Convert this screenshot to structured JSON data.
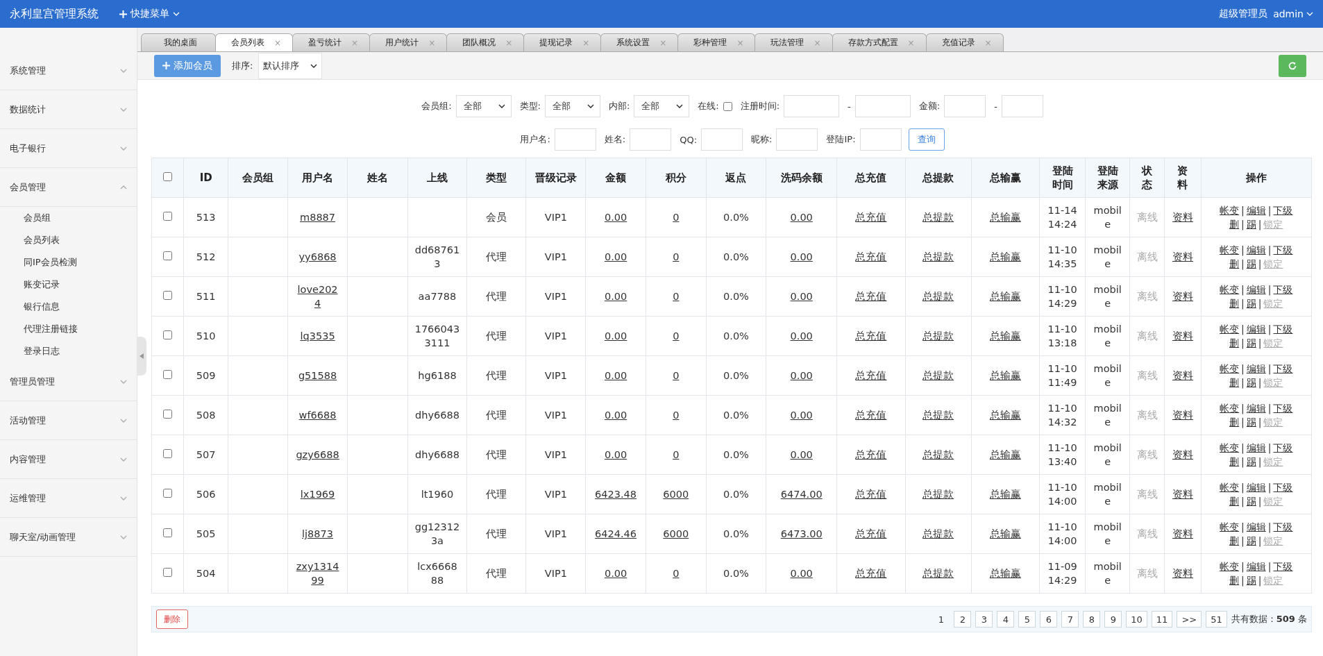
{
  "app_title": "永利皇宫管理系统",
  "quick_menu": "快捷菜单",
  "user": {
    "role": "超级管理员",
    "name": "admin"
  },
  "sidebar": [
    {
      "label": "系统管理",
      "expanded": false
    },
    {
      "label": "数据统计",
      "expanded": false
    },
    {
      "label": "电子银行",
      "expanded": false
    },
    {
      "label": "会员管理",
      "expanded": true,
      "children": [
        {
          "label": "会员组"
        },
        {
          "label": "会员列表"
        },
        {
          "label": "同IP会员检测"
        },
        {
          "label": "账变记录"
        },
        {
          "label": "银行信息"
        },
        {
          "label": "代理注册链接"
        },
        {
          "label": "登录日志"
        }
      ]
    },
    {
      "label": "管理员管理",
      "expanded": false
    },
    {
      "label": "活动管理",
      "expanded": false
    },
    {
      "label": "内容管理",
      "expanded": false
    },
    {
      "label": "运维管理",
      "expanded": false
    },
    {
      "label": "聊天室/动画管理",
      "expanded": false
    }
  ],
  "tabs": [
    {
      "label": "我的桌面",
      "selected": false
    },
    {
      "label": "会员列表",
      "selected": true,
      "close": "×"
    },
    {
      "label": "盈亏统计",
      "selected": false,
      "close": "×"
    },
    {
      "label": "用户统计",
      "selected": false,
      "close": "×"
    },
    {
      "label": "团队概况",
      "selected": false,
      "close": "×"
    },
    {
      "label": "提现记录",
      "selected": false,
      "close": "×"
    },
    {
      "label": "系统设置",
      "selected": false,
      "close": "×"
    },
    {
      "label": "彩种管理",
      "selected": false,
      "close": "×"
    },
    {
      "label": "玩法管理",
      "selected": false,
      "close": "×"
    },
    {
      "label": "存款方式配置",
      "selected": false,
      "close": "×"
    },
    {
      "label": "充值记录",
      "selected": false,
      "close": "×"
    }
  ],
  "toolbar": {
    "add_button": "添加会员",
    "sort_label": "排序:",
    "sort_value": "默认排序"
  },
  "filters": {
    "row1": [
      {
        "kind": "select",
        "label": "会员组:",
        "value": "全部"
      },
      {
        "kind": "select",
        "label": "类型:",
        "value": "全部"
      },
      {
        "kind": "select",
        "label": "内部:",
        "value": "全部"
      },
      {
        "kind": "checkbox",
        "label": "在线:",
        "checked": false
      },
      {
        "kind": "range",
        "label": "注册时间:",
        "separator": "-"
      },
      {
        "kind": "range",
        "label": "金额:",
        "separator": "-"
      }
    ],
    "row2": [
      {
        "label": "用户名:"
      },
      {
        "label": "姓名:"
      },
      {
        "label": "QQ:"
      },
      {
        "label": "昵称:"
      },
      {
        "label": "登陆IP:"
      }
    ],
    "search_button": "查询"
  },
  "table": {
    "all_checked": false,
    "columns": [
      "ID",
      "会员组",
      "用户名",
      "姓名",
      "上线",
      "类型",
      "晋级记录",
      "金额",
      "积分",
      "返点",
      "洗码余额",
      "总充值",
      "总提款",
      "总输赢",
      "登陆时间",
      "登陆来源",
      "状态",
      "资料",
      "操作"
    ],
    "op_separator": "|",
    "rows": [
      {
        "selected": false,
        "id": "513",
        "group": "",
        "username": "m8887",
        "name": "",
        "parent": "",
        "type": "会员",
        "level": "VIP1",
        "amount": "0.00",
        "points": "0",
        "rebate": "0.0%",
        "wash": "0.00",
        "recharge": "总充值",
        "withdraw": "总提款",
        "winloss": "总输赢",
        "login_time": "11-14 14:24",
        "source": "mobile",
        "status": "离线",
        "profile": "资料",
        "ops": [
          {
            "label": "帐变",
            "disabled": false
          },
          {
            "label": "编辑",
            "disabled": false
          },
          {
            "label": "下级",
            "disabled": false
          },
          {
            "label": "删",
            "disabled": false
          },
          {
            "label": "踢",
            "disabled": false
          },
          {
            "label": "锁定",
            "disabled": true
          }
        ]
      },
      {
        "selected": false,
        "id": "512",
        "group": "",
        "username": "yy6868",
        "name": "",
        "parent": "dd687613",
        "type": "代理",
        "level": "VIP1",
        "amount": "0.00",
        "points": "0",
        "rebate": "0.0%",
        "wash": "0.00",
        "recharge": "总充值",
        "withdraw": "总提款",
        "winloss": "总输赢",
        "login_time": "11-10 14:35",
        "source": "mobile",
        "status": "离线",
        "profile": "资料",
        "ops": [
          {
            "label": "帐变",
            "disabled": false
          },
          {
            "label": "编辑",
            "disabled": false
          },
          {
            "label": "下级",
            "disabled": false
          },
          {
            "label": "删",
            "disabled": false
          },
          {
            "label": "踢",
            "disabled": false
          },
          {
            "label": "锁定",
            "disabled": true
          }
        ]
      },
      {
        "selected": false,
        "id": "511",
        "group": "",
        "username": "love2024",
        "name": "",
        "parent": "aa7788",
        "type": "代理",
        "level": "VIP1",
        "amount": "0.00",
        "points": "0",
        "rebate": "0.0%",
        "wash": "0.00",
        "recharge": "总充值",
        "withdraw": "总提款",
        "winloss": "总输赢",
        "login_time": "11-10 14:29",
        "source": "mobile",
        "status": "离线",
        "profile": "资料",
        "ops": [
          {
            "label": "帐变",
            "disabled": false
          },
          {
            "label": "编辑",
            "disabled": false
          },
          {
            "label": "下级",
            "disabled": false
          },
          {
            "label": "删",
            "disabled": false
          },
          {
            "label": "踢",
            "disabled": false
          },
          {
            "label": "锁定",
            "disabled": true
          }
        ]
      },
      {
        "selected": false,
        "id": "510",
        "group": "",
        "username": "lq3535",
        "name": "",
        "parent": "17660433111",
        "type": "代理",
        "level": "VIP1",
        "amount": "0.00",
        "points": "0",
        "rebate": "0.0%",
        "wash": "0.00",
        "recharge": "总充值",
        "withdraw": "总提款",
        "winloss": "总输赢",
        "login_time": "11-10 13:18",
        "source": "mobile",
        "status": "离线",
        "profile": "资料",
        "ops": [
          {
            "label": "帐变",
            "disabled": false
          },
          {
            "label": "编辑",
            "disabled": false
          },
          {
            "label": "下级",
            "disabled": false
          },
          {
            "label": "删",
            "disabled": false
          },
          {
            "label": "踢",
            "disabled": false
          },
          {
            "label": "锁定",
            "disabled": true
          }
        ]
      },
      {
        "selected": false,
        "id": "509",
        "group": "",
        "username": "g51588",
        "name": "",
        "parent": "hg6188",
        "type": "代理",
        "level": "VIP1",
        "amount": "0.00",
        "points": "0",
        "rebate": "0.0%",
        "wash": "0.00",
        "recharge": "总充值",
        "withdraw": "总提款",
        "winloss": "总输赢",
        "login_time": "11-10 11:49",
        "source": "mobile",
        "status": "离线",
        "profile": "资料",
        "ops": [
          {
            "label": "帐变",
            "disabled": false
          },
          {
            "label": "编辑",
            "disabled": false
          },
          {
            "label": "下级",
            "disabled": false
          },
          {
            "label": "删",
            "disabled": false
          },
          {
            "label": "踢",
            "disabled": false
          },
          {
            "label": "锁定",
            "disabled": true
          }
        ]
      },
      {
        "selected": false,
        "id": "508",
        "group": "",
        "username": "wf6688",
        "name": "",
        "parent": "dhy6688",
        "type": "代理",
        "level": "VIP1",
        "amount": "0.00",
        "points": "0",
        "rebate": "0.0%",
        "wash": "0.00",
        "recharge": "总充值",
        "withdraw": "总提款",
        "winloss": "总输赢",
        "login_time": "11-10 14:32",
        "source": "mobile",
        "status": "离线",
        "profile": "资料",
        "ops": [
          {
            "label": "帐变",
            "disabled": false
          },
          {
            "label": "编辑",
            "disabled": false
          },
          {
            "label": "下级",
            "disabled": false
          },
          {
            "label": "删",
            "disabled": false
          },
          {
            "label": "踢",
            "disabled": false
          },
          {
            "label": "锁定",
            "disabled": true
          }
        ]
      },
      {
        "selected": false,
        "id": "507",
        "group": "",
        "username": "gzy6688",
        "name": "",
        "parent": "dhy6688",
        "type": "代理",
        "level": "VIP1",
        "amount": "0.00",
        "points": "0",
        "rebate": "0.0%",
        "wash": "0.00",
        "recharge": "总充值",
        "withdraw": "总提款",
        "winloss": "总输赢",
        "login_time": "11-10 13:40",
        "source": "mobile",
        "status": "离线",
        "profile": "资料",
        "ops": [
          {
            "label": "帐变",
            "disabled": false
          },
          {
            "label": "编辑",
            "disabled": false
          },
          {
            "label": "下级",
            "disabled": false
          },
          {
            "label": "删",
            "disabled": false
          },
          {
            "label": "踢",
            "disabled": false
          },
          {
            "label": "锁定",
            "disabled": true
          }
        ]
      },
      {
        "selected": false,
        "id": "506",
        "group": "",
        "username": "lx1969",
        "name": "",
        "parent": "lt1960",
        "type": "代理",
        "level": "VIP1",
        "amount": "6423.48",
        "points": "6000",
        "rebate": "0.0%",
        "wash": "6474.00",
        "recharge": "总充值",
        "withdraw": "总提款",
        "winloss": "总输赢",
        "login_time": "11-10 14:00",
        "source": "mobile",
        "status": "离线",
        "profile": "资料",
        "ops": [
          {
            "label": "帐变",
            "disabled": false
          },
          {
            "label": "编辑",
            "disabled": false
          },
          {
            "label": "下级",
            "disabled": false
          },
          {
            "label": "删",
            "disabled": false
          },
          {
            "label": "踢",
            "disabled": false
          },
          {
            "label": "锁定",
            "disabled": true
          }
        ]
      },
      {
        "selected": false,
        "id": "505",
        "group": "",
        "username": "lj8873",
        "name": "",
        "parent": "gg123123a",
        "type": "代理",
        "level": "VIP1",
        "amount": "6424.46",
        "points": "6000",
        "rebate": "0.0%",
        "wash": "6473.00",
        "recharge": "总充值",
        "withdraw": "总提款",
        "winloss": "总输赢",
        "login_time": "11-10 14:00",
        "source": "mobile",
        "status": "离线",
        "profile": "资料",
        "ops": [
          {
            "label": "帐变",
            "disabled": false
          },
          {
            "label": "编辑",
            "disabled": false
          },
          {
            "label": "下级",
            "disabled": false
          },
          {
            "label": "删",
            "disabled": false
          },
          {
            "label": "踢",
            "disabled": false
          },
          {
            "label": "锁定",
            "disabled": true
          }
        ]
      },
      {
        "selected": false,
        "id": "504",
        "group": "",
        "username": "zxy131499",
        "name": "",
        "parent": "lcx666888",
        "type": "代理",
        "level": "VIP1",
        "amount": "0.00",
        "points": "0",
        "rebate": "0.0%",
        "wash": "0.00",
        "recharge": "总充值",
        "withdraw": "总提款",
        "winloss": "总输赢",
        "login_time": "11-09 14:29",
        "source": "mobile",
        "status": "离线",
        "profile": "资料",
        "ops": [
          {
            "label": "帐变",
            "disabled": false
          },
          {
            "label": "编辑",
            "disabled": false
          },
          {
            "label": "下级",
            "disabled": false
          },
          {
            "label": "删",
            "disabled": false
          },
          {
            "label": "踢",
            "disabled": false
          },
          {
            "label": "锁定",
            "disabled": true
          }
        ]
      }
    ]
  },
  "footer": {
    "delete_button": "删除",
    "pages": [
      {
        "label": "1",
        "selected": true
      },
      {
        "label": "2",
        "selected": false
      },
      {
        "label": "3",
        "selected": false
      },
      {
        "label": "4",
        "selected": false
      },
      {
        "label": "5",
        "selected": false
      },
      {
        "label": "6",
        "selected": false
      },
      {
        "label": "7",
        "selected": false
      },
      {
        "label": "8",
        "selected": false
      },
      {
        "label": "9",
        "selected": false
      },
      {
        "label": "10",
        "selected": false
      },
      {
        "label": "11",
        "selected": false
      },
      {
        "label": ">>",
        "selected": false
      },
      {
        "label": "51",
        "selected": false
      }
    ],
    "total": "共有数据：**509** 条"
  }
}
